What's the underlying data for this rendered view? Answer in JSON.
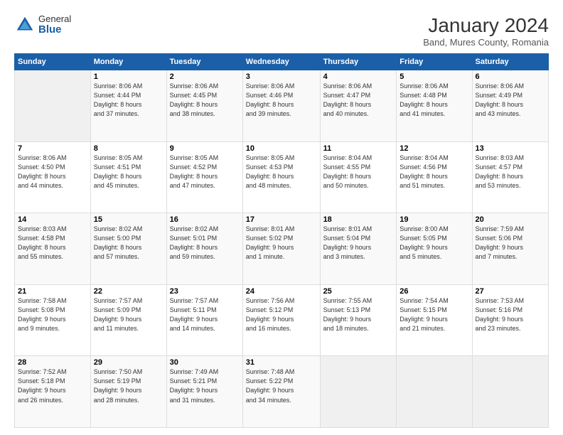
{
  "logo": {
    "general": "General",
    "blue": "Blue"
  },
  "title": "January 2024",
  "location": "Band, Mures County, Romania",
  "days_header": [
    "Sunday",
    "Monday",
    "Tuesday",
    "Wednesday",
    "Thursday",
    "Friday",
    "Saturday"
  ],
  "weeks": [
    [
      {
        "day": "",
        "info": ""
      },
      {
        "day": "1",
        "info": "Sunrise: 8:06 AM\nSunset: 4:44 PM\nDaylight: 8 hours\nand 37 minutes."
      },
      {
        "day": "2",
        "info": "Sunrise: 8:06 AM\nSunset: 4:45 PM\nDaylight: 8 hours\nand 38 minutes."
      },
      {
        "day": "3",
        "info": "Sunrise: 8:06 AM\nSunset: 4:46 PM\nDaylight: 8 hours\nand 39 minutes."
      },
      {
        "day": "4",
        "info": "Sunrise: 8:06 AM\nSunset: 4:47 PM\nDaylight: 8 hours\nand 40 minutes."
      },
      {
        "day": "5",
        "info": "Sunrise: 8:06 AM\nSunset: 4:48 PM\nDaylight: 8 hours\nand 41 minutes."
      },
      {
        "day": "6",
        "info": "Sunrise: 8:06 AM\nSunset: 4:49 PM\nDaylight: 8 hours\nand 43 minutes."
      }
    ],
    [
      {
        "day": "7",
        "info": "Sunrise: 8:06 AM\nSunset: 4:50 PM\nDaylight: 8 hours\nand 44 minutes."
      },
      {
        "day": "8",
        "info": "Sunrise: 8:05 AM\nSunset: 4:51 PM\nDaylight: 8 hours\nand 45 minutes."
      },
      {
        "day": "9",
        "info": "Sunrise: 8:05 AM\nSunset: 4:52 PM\nDaylight: 8 hours\nand 47 minutes."
      },
      {
        "day": "10",
        "info": "Sunrise: 8:05 AM\nSunset: 4:53 PM\nDaylight: 8 hours\nand 48 minutes."
      },
      {
        "day": "11",
        "info": "Sunrise: 8:04 AM\nSunset: 4:55 PM\nDaylight: 8 hours\nand 50 minutes."
      },
      {
        "day": "12",
        "info": "Sunrise: 8:04 AM\nSunset: 4:56 PM\nDaylight: 8 hours\nand 51 minutes."
      },
      {
        "day": "13",
        "info": "Sunrise: 8:03 AM\nSunset: 4:57 PM\nDaylight: 8 hours\nand 53 minutes."
      }
    ],
    [
      {
        "day": "14",
        "info": "Sunrise: 8:03 AM\nSunset: 4:58 PM\nDaylight: 8 hours\nand 55 minutes."
      },
      {
        "day": "15",
        "info": "Sunrise: 8:02 AM\nSunset: 5:00 PM\nDaylight: 8 hours\nand 57 minutes."
      },
      {
        "day": "16",
        "info": "Sunrise: 8:02 AM\nSunset: 5:01 PM\nDaylight: 8 hours\nand 59 minutes."
      },
      {
        "day": "17",
        "info": "Sunrise: 8:01 AM\nSunset: 5:02 PM\nDaylight: 9 hours\nand 1 minute."
      },
      {
        "day": "18",
        "info": "Sunrise: 8:01 AM\nSunset: 5:04 PM\nDaylight: 9 hours\nand 3 minutes."
      },
      {
        "day": "19",
        "info": "Sunrise: 8:00 AM\nSunset: 5:05 PM\nDaylight: 9 hours\nand 5 minutes."
      },
      {
        "day": "20",
        "info": "Sunrise: 7:59 AM\nSunset: 5:06 PM\nDaylight: 9 hours\nand 7 minutes."
      }
    ],
    [
      {
        "day": "21",
        "info": "Sunrise: 7:58 AM\nSunset: 5:08 PM\nDaylight: 9 hours\nand 9 minutes."
      },
      {
        "day": "22",
        "info": "Sunrise: 7:57 AM\nSunset: 5:09 PM\nDaylight: 9 hours\nand 11 minutes."
      },
      {
        "day": "23",
        "info": "Sunrise: 7:57 AM\nSunset: 5:11 PM\nDaylight: 9 hours\nand 14 minutes."
      },
      {
        "day": "24",
        "info": "Sunrise: 7:56 AM\nSunset: 5:12 PM\nDaylight: 9 hours\nand 16 minutes."
      },
      {
        "day": "25",
        "info": "Sunrise: 7:55 AM\nSunset: 5:13 PM\nDaylight: 9 hours\nand 18 minutes."
      },
      {
        "day": "26",
        "info": "Sunrise: 7:54 AM\nSunset: 5:15 PM\nDaylight: 9 hours\nand 21 minutes."
      },
      {
        "day": "27",
        "info": "Sunrise: 7:53 AM\nSunset: 5:16 PM\nDaylight: 9 hours\nand 23 minutes."
      }
    ],
    [
      {
        "day": "28",
        "info": "Sunrise: 7:52 AM\nSunset: 5:18 PM\nDaylight: 9 hours\nand 26 minutes."
      },
      {
        "day": "29",
        "info": "Sunrise: 7:50 AM\nSunset: 5:19 PM\nDaylight: 9 hours\nand 28 minutes."
      },
      {
        "day": "30",
        "info": "Sunrise: 7:49 AM\nSunset: 5:21 PM\nDaylight: 9 hours\nand 31 minutes."
      },
      {
        "day": "31",
        "info": "Sunrise: 7:48 AM\nSunset: 5:22 PM\nDaylight: 9 hours\nand 34 minutes."
      },
      {
        "day": "",
        "info": ""
      },
      {
        "day": "",
        "info": ""
      },
      {
        "day": "",
        "info": ""
      }
    ]
  ]
}
